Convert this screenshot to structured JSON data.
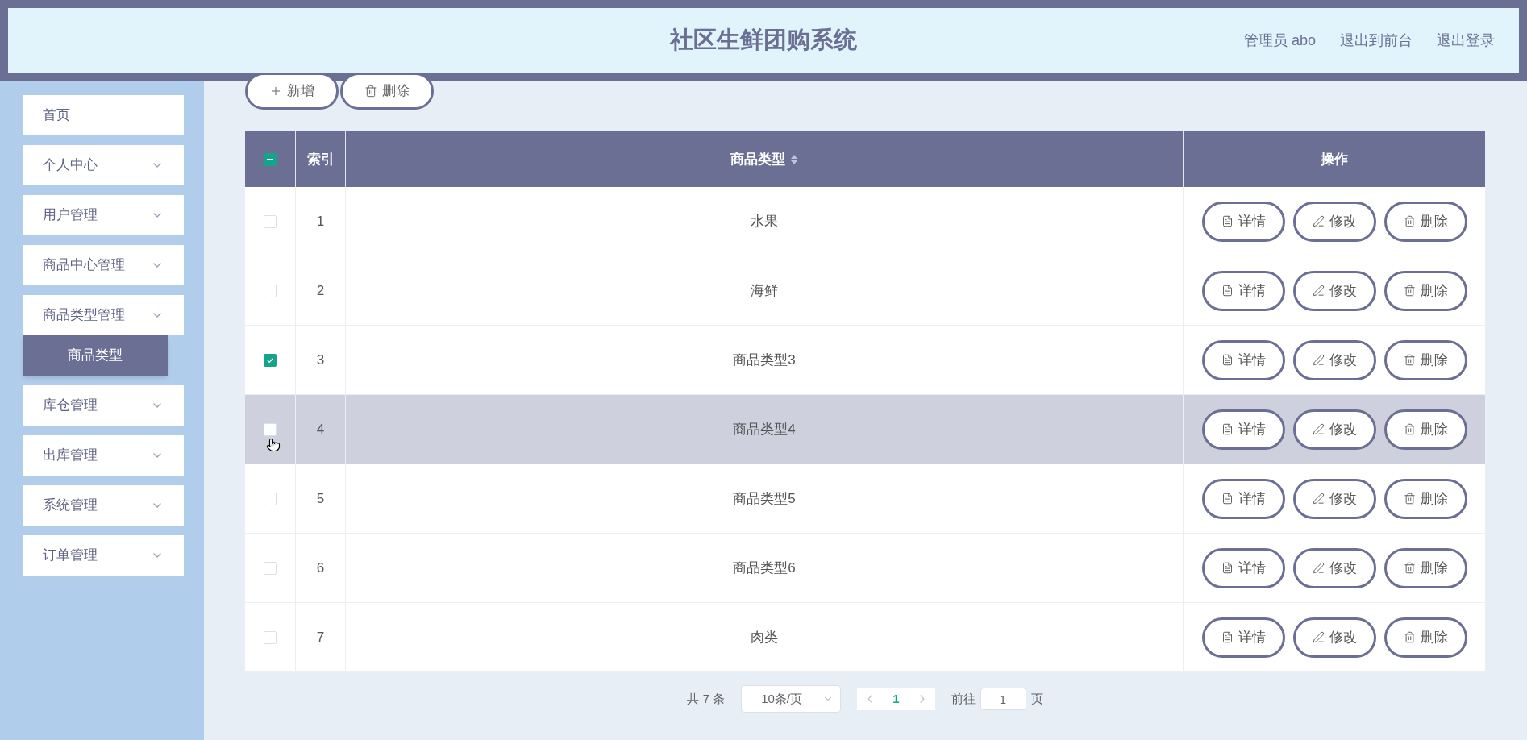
{
  "header": {
    "title": "社区生鲜团购系统",
    "links": [
      "管理员 abo",
      "退出到前台",
      "退出登录"
    ]
  },
  "sidebar": {
    "items": [
      {
        "label": "首页",
        "has_children": false
      },
      {
        "label": "个人中心",
        "has_children": true,
        "expanded": false
      },
      {
        "label": "用户管理",
        "has_children": true,
        "expanded": false
      },
      {
        "label": "商品中心管理",
        "has_children": true,
        "expanded": false
      },
      {
        "label": "商品类型管理",
        "has_children": true,
        "expanded": true,
        "children": [
          {
            "label": "商品类型",
            "selected": true
          }
        ]
      },
      {
        "label": "库仓管理",
        "has_children": true,
        "expanded": false
      },
      {
        "label": "出库管理",
        "has_children": true,
        "expanded": false
      },
      {
        "label": "系统管理",
        "has_children": true,
        "expanded": false
      },
      {
        "label": "订单管理",
        "has_children": true,
        "expanded": false
      }
    ]
  },
  "toolbar": {
    "buttons": [
      {
        "kind": "add",
        "label": "新增"
      },
      {
        "kind": "delete",
        "label": "删除"
      }
    ]
  },
  "table": {
    "select_all_indeterminate": true,
    "columns": [
      {
        "label": "索引",
        "sortable": false
      },
      {
        "label": "商品类型",
        "sortable": true
      },
      {
        "label": "操作",
        "sortable": false
      }
    ],
    "rows": [
      {
        "index": "1",
        "type": "水果",
        "checked": false,
        "hovered": false,
        "actions": [
          {
            "kind": "detail",
            "label": "详情"
          },
          {
            "kind": "edit",
            "label": "修改"
          },
          {
            "kind": "delete",
            "label": "删除"
          }
        ]
      },
      {
        "index": "2",
        "type": "海鲜",
        "checked": false,
        "hovered": false,
        "actions": [
          {
            "kind": "detail",
            "label": "详情"
          },
          {
            "kind": "edit",
            "label": "修改"
          },
          {
            "kind": "delete",
            "label": "删除"
          }
        ]
      },
      {
        "index": "3",
        "type": "商品类型3",
        "checked": true,
        "hovered": false,
        "actions": [
          {
            "kind": "detail",
            "label": "详情"
          },
          {
            "kind": "edit",
            "label": "修改"
          },
          {
            "kind": "delete",
            "label": "删除"
          }
        ]
      },
      {
        "index": "4",
        "type": "商品类型4",
        "checked": false,
        "hovered": true,
        "actions": [
          {
            "kind": "detail",
            "label": "详情"
          },
          {
            "kind": "edit",
            "label": "修改"
          },
          {
            "kind": "delete",
            "label": "删除"
          }
        ]
      },
      {
        "index": "5",
        "type": "商品类型5",
        "checked": false,
        "hovered": false,
        "actions": [
          {
            "kind": "detail",
            "label": "详情"
          },
          {
            "kind": "edit",
            "label": "修改"
          },
          {
            "kind": "delete",
            "label": "删除"
          }
        ]
      },
      {
        "index": "6",
        "type": "商品类型6",
        "checked": false,
        "hovered": false,
        "actions": [
          {
            "kind": "detail",
            "label": "详情"
          },
          {
            "kind": "edit",
            "label": "修改"
          },
          {
            "kind": "delete",
            "label": "删除"
          }
        ]
      },
      {
        "index": "7",
        "type": "肉类",
        "checked": false,
        "hovered": false,
        "actions": [
          {
            "kind": "detail",
            "label": "详情"
          },
          {
            "kind": "edit",
            "label": "修改"
          },
          {
            "kind": "delete",
            "label": "删除"
          }
        ]
      }
    ]
  },
  "pagination": {
    "total": "共 7 条",
    "page_size": "10条/页",
    "pages": [
      {
        "label": "1",
        "selected": true
      }
    ],
    "goto_label": "前往",
    "goto_value": "1",
    "goto_suffix": "页"
  }
}
